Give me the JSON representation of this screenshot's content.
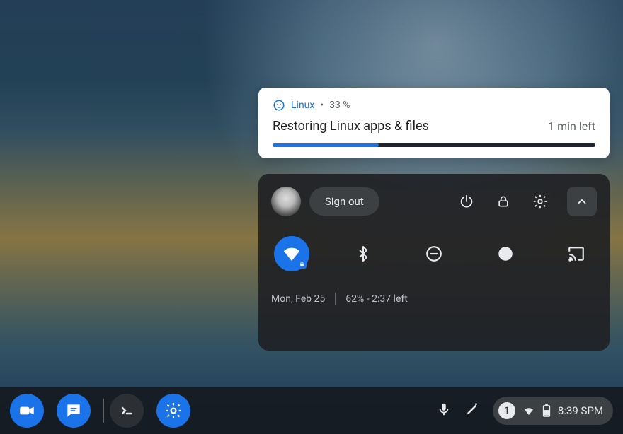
{
  "notification": {
    "app_name": "Linux",
    "separator": "•",
    "progress_label": "33 %",
    "progress_value": 33,
    "title": "Restoring Linux apps & files",
    "eta": "1 min left"
  },
  "quick_settings": {
    "signout_label": "Sign out",
    "toggles": {
      "wifi": "on",
      "bluetooth": "off",
      "dnd": "off",
      "nightlight": "off",
      "cast": "off"
    },
    "footer_date": "Mon, Feb 25",
    "footer_battery": "62% - 2:37 left"
  },
  "shelf": {
    "voice_icon": "mic",
    "stylus_icon": "stylus",
    "notification_count": "1",
    "time": "8:39 SPM"
  },
  "colors": {
    "accent": "#1a73e8",
    "panel": "#202124"
  }
}
